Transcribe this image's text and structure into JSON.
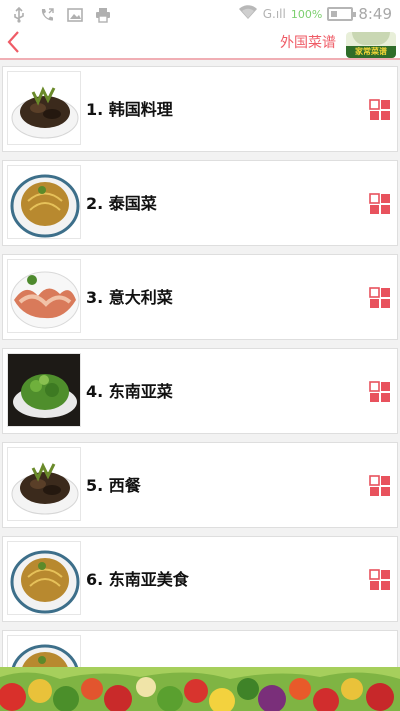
{
  "status_bar": {
    "network_text": "G.ıll",
    "battery_text": "100%",
    "time": "8:49"
  },
  "header": {
    "title": "外国菜谱",
    "logo_text": "家常菜谱"
  },
  "items": [
    {
      "label": "1. 韩国料理",
      "thumb": "braised-mushroom-dish"
    },
    {
      "label": "2. 泰国菜",
      "thumb": "noodle-dish"
    },
    {
      "label": "3. 意大利菜",
      "thumb": "sliced-meat-platter"
    },
    {
      "label": "4. 东南亚菜",
      "thumb": "green-vegetable-dish"
    },
    {
      "label": "5. 西餐",
      "thumb": "braised-mushroom-dish"
    },
    {
      "label": "6. 东南亚美食",
      "thumb": "noodle-dish"
    },
    {
      "label": "",
      "thumb": "noodle-dish"
    }
  ],
  "colors": {
    "accent": "#ef5b66",
    "grid_icon": "#e8525d",
    "header_border": "#f0aeb4"
  },
  "icons": {
    "back": "chevron-left-icon",
    "grid": "grid-icon",
    "usb": "usb-icon",
    "phone": "phone-icon",
    "image": "image-icon",
    "printer": "printer-icon",
    "wifi": "wifi-icon",
    "battery": "battery-icon"
  }
}
